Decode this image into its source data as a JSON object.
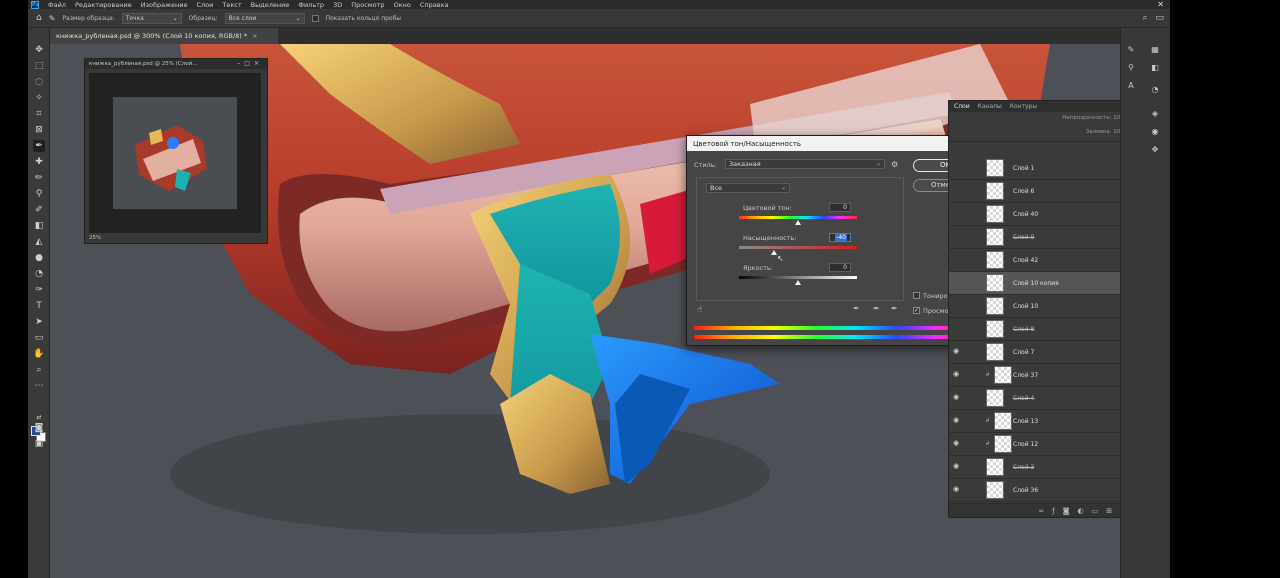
{
  "menu": {
    "logo": "Ps",
    "items": [
      "Файл",
      "Редактирование",
      "Изображение",
      "Слои",
      "Текст",
      "Выделение",
      "Фильтр",
      "3D",
      "Просмотр",
      "Окно",
      "Справка"
    ],
    "close": "✕"
  },
  "options": {
    "size_label": "Размер образца:",
    "size_value": "Точка",
    "sample_label": "Образец:",
    "sample_value": "Все слои",
    "ring_label": "Показать кольцо пробы"
  },
  "doc_tab": {
    "title": "книжка_рубленая.psd @ 300% (Слой 10 копия, RGB/8) *",
    "close": "×"
  },
  "navigator": {
    "title": "книжка_рубленая.psd @ 25% (Слой...",
    "zoom": "25%",
    "controls": "–□×"
  },
  "dialog": {
    "title": "Цветовой тон/Насыщенность",
    "close": "✕",
    "style_label": "Стиль:",
    "style_value": "Заказная",
    "channel_value": "Все",
    "hue_label": "Цветовой тон:",
    "hue_value": "0",
    "hue_fraction": 0.5,
    "saturation_label": "Насыщенность:",
    "saturation_value": "-40",
    "saturation_fraction": 0.3,
    "lightness_label": "Яркость:",
    "lightness_value": "0",
    "lightness_fraction": 0.5,
    "ok_label": "OK",
    "cancel_label": "Отмена",
    "colorize_label": "Тонирование",
    "colorize_checked": false,
    "preview_label": "Просмотр",
    "preview_checked": true
  },
  "layers_panel": {
    "tabs": [
      "Слои",
      "Каналы",
      "Контуры"
    ],
    "opacity_label": "Непрозрачность:",
    "opacity_value": "100%",
    "fill_label": "Заливка:",
    "fill_value": "100%",
    "rows": [
      {
        "name": "Слой 1",
        "visible": false,
        "clipped": false,
        "locked": false,
        "struck": false,
        "selected": false
      },
      {
        "name": "Слой 6",
        "visible": false,
        "clipped": false,
        "locked": false,
        "struck": false,
        "selected": false
      },
      {
        "name": "Слой 40",
        "visible": false,
        "clipped": false,
        "locked": false,
        "struck": false,
        "selected": false
      },
      {
        "name": "Слой 9",
        "visible": false,
        "clipped": false,
        "locked": true,
        "struck": true,
        "selected": false
      },
      {
        "name": "Слой 42",
        "visible": false,
        "clipped": false,
        "locked": false,
        "struck": false,
        "selected": false
      },
      {
        "name": "Слой 10 копия",
        "visible": false,
        "clipped": false,
        "locked": false,
        "struck": false,
        "selected": true
      },
      {
        "name": "Слой 10",
        "visible": false,
        "clipped": false,
        "locked": true,
        "struck": false,
        "selected": false
      },
      {
        "name": "Слой 8",
        "visible": false,
        "clipped": false,
        "locked": true,
        "struck": true,
        "selected": false
      },
      {
        "name": "Слой 7",
        "visible": true,
        "clipped": false,
        "locked": true,
        "struck": false,
        "selected": false
      },
      {
        "name": "Слой 37",
        "visible": true,
        "clipped": true,
        "locked": false,
        "struck": false,
        "selected": false
      },
      {
        "name": "Слой 4",
        "visible": true,
        "clipped": false,
        "locked": true,
        "struck": true,
        "selected": false
      },
      {
        "name": "Слой 13",
        "visible": true,
        "clipped": true,
        "locked": false,
        "struck": false,
        "selected": false
      },
      {
        "name": "Слой 12",
        "visible": true,
        "clipped": true,
        "locked": false,
        "struck": false,
        "selected": false
      },
      {
        "name": "Слой 3",
        "visible": true,
        "clipped": false,
        "locked": true,
        "struck": true,
        "selected": false
      },
      {
        "name": "Слой 36",
        "visible": true,
        "clipped": false,
        "locked": false,
        "struck": false,
        "selected": false
      }
    ],
    "footer_icons": [
      "link-icon",
      "fx-icon",
      "mask-icon",
      "adjustment-icon",
      "folder-icon",
      "new-layer-icon",
      "trash-icon"
    ]
  },
  "colors": {
    "foreground_swatch": "#2c4a9a",
    "background_swatch": "#ffffff",
    "canvas_bg": "#4d5056"
  }
}
